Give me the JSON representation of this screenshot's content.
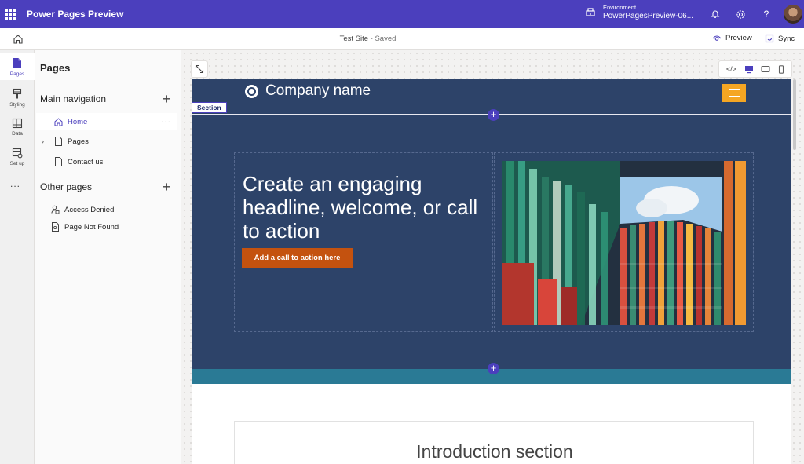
{
  "app": {
    "title": "Power Pages Preview"
  },
  "environment": {
    "label": "Environment",
    "name": "PowerPagesPreview-06..."
  },
  "command_bar": {
    "site_name": "Test Site",
    "separator": " - ",
    "site_status": "Saved",
    "preview_label": "Preview",
    "sync_label": "Sync"
  },
  "rail": {
    "items": [
      {
        "label": "Pages",
        "icon": "page-icon"
      },
      {
        "label": "Styling",
        "icon": "paintbrush-icon"
      },
      {
        "label": "Data",
        "icon": "table-icon"
      },
      {
        "label": "Set up",
        "icon": "setup-icon"
      }
    ],
    "more": "..."
  },
  "pages_panel": {
    "title": "Pages",
    "main_nav": {
      "heading": "Main navigation",
      "items": [
        {
          "label": "Home",
          "icon": "home-icon"
        },
        {
          "label": "Pages",
          "icon": "page-icon"
        },
        {
          "label": "Contact us",
          "icon": "page-icon"
        }
      ]
    },
    "other_pages": {
      "heading": "Other pages",
      "items": [
        {
          "label": "Access Denied",
          "icon": "person-lock-icon"
        },
        {
          "label": "Page Not Found",
          "icon": "page-search-icon"
        }
      ]
    }
  },
  "site": {
    "company_name": "Company name",
    "section_tag": "Section",
    "headline": "Create an engaging headline, welcome, or call to action",
    "cta_label": "Add a call to action here",
    "intro_title": "Introduction section"
  },
  "colors": {
    "brand": "#4b3fbd",
    "site_header": "#2d4369",
    "menu_button": "#f5a623",
    "cta": "#c4520f",
    "teal_band": "#2a7a95"
  }
}
